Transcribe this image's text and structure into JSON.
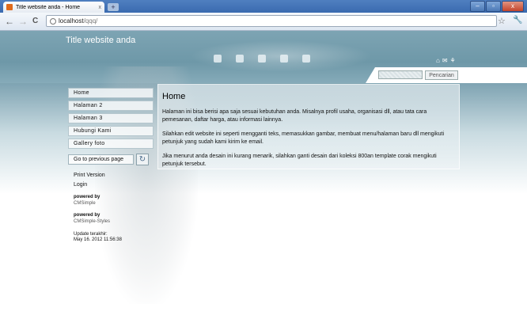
{
  "browser": {
    "tab_title": "Title website anda - Home",
    "tab_close": "x",
    "new_tab": "+",
    "url_host": "localhost",
    "url_path": "/qqq/",
    "back": "←",
    "forward": "→",
    "reload": "C",
    "star": "☆",
    "wrench": "🔧",
    "window_controls": {
      "minimize": "–",
      "maximize": "▫",
      "close": "x"
    }
  },
  "header": {
    "site_title": "Title website anda",
    "icons": [
      "home-icon",
      "mail-icon",
      "sitemap-icon"
    ],
    "icon_glyphs": {
      "home": "⌂",
      "mail": "✉",
      "sitemap": "⚘"
    },
    "search_button": "Pencarian",
    "search_value": ""
  },
  "sidebar": {
    "items": [
      {
        "label": "Home"
      },
      {
        "label": "Halaman 2"
      },
      {
        "label": "Halaman 3"
      },
      {
        "label": "Hubungi Kami"
      },
      {
        "label": "Gallery foto"
      }
    ],
    "previous_page": "Go to previous page",
    "refresh_glyph": "↻",
    "print_version": "Print Version",
    "login": "Login",
    "powered_by_1_label": "powered by",
    "powered_by_1_value": "CMSimple",
    "powered_by_2_label": "powered by",
    "powered_by_2_value": "CMSimple-Styles",
    "update_label": "Update terakhir:",
    "update_value": "May 16. 2012 11:56:38"
  },
  "main": {
    "heading": "Home",
    "paragraphs": [
      "Halaman ini bisa berisi apa saja sesuai kebutuhan anda. Misalnya profil usaha, organisasi dll, atau tata cara pemesanan, daftar harga, atau informasi lainnya.",
      "Silahkan edit website ini seperti mengganti teks, memasukkan gambar, membuat menu/halaman baru dll mengikuti petunjuk yang sudah kami kirim ke email.",
      "Jika menurut anda desain ini kurang menarik, silahkan ganti desain dari koleksi 800an template corak mengikuti petunjuk tersebut."
    ]
  }
}
